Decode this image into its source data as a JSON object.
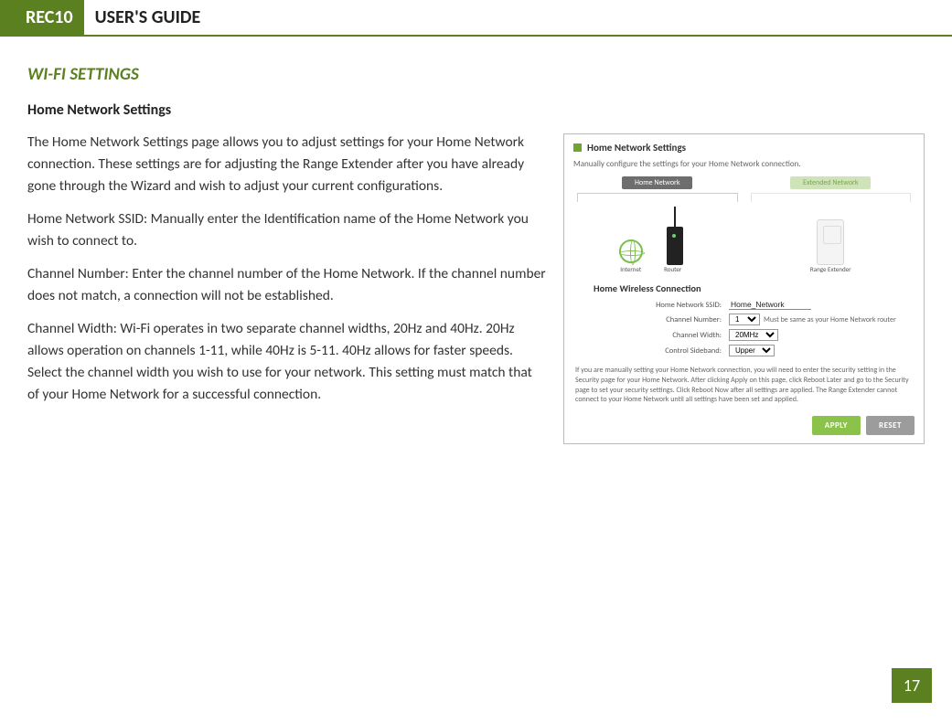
{
  "header": {
    "badge": "REC10",
    "title": "USER'S GUIDE"
  },
  "section_title": "WI-FI SETTINGS",
  "sub_title": "Home Network Settings",
  "paras": {
    "p1": "The Home Network Settings page allows you to adjust settings for your Home Network connection. These settings are for adjusting the Range Extender after you have already gone through the Wizard and wish to adjust your current configurations.",
    "p2": "Home Network SSID: Manually enter the Identification name of the Home Network you wish to connect to.",
    "p3": "Channel Number: Enter the channel number of the Home Network.  If the channel number does not match, a connection will not be established.",
    "p4": "Channel Width: Wi-Fi operates in two separate channel widths, 20Hz and 40Hz.  20Hz allows operation on channels 1-11, while 40Hz is 5-11.  40Hz allows for faster speeds.  Select the channel width you wish to use for your network.  This setting must match that of your Home Network for a successful connection."
  },
  "shot": {
    "title": "Home Network Settings",
    "subtitle": "Manually configure the settings for your Home Network connection.",
    "tab_home": "Home Network",
    "tab_ext": "Extended Network",
    "lbl_internet": "Internet",
    "lbl_router": "Router",
    "lbl_extender": "Range Extender",
    "h2": "Home Wireless Connection",
    "form": {
      "ssid_lbl": "Home Network SSID:",
      "ssid_val": "Home_Network",
      "chnum_lbl": "Channel Number:",
      "chnum_val": "1",
      "chnum_note": "Must be same as your Home Network router",
      "chwidth_lbl": "Channel Width:",
      "chwidth_val": "20MHz",
      "sideband_lbl": "Control Sideband:",
      "sideband_val": "Upper"
    },
    "footnote": "If you are manually setting your Home Network connection, you will need to enter the security setting in the Security page for your Home Network. After clicking Apply on this page, click Reboot Later and go to the Security page to set your security settings. Click Reboot Now after all settings are applied. The Range Extender cannot connect to your Home Network until all settings have been set and applied.",
    "btn_apply": "APPLY",
    "btn_reset": "RESET"
  },
  "page_number": "17"
}
